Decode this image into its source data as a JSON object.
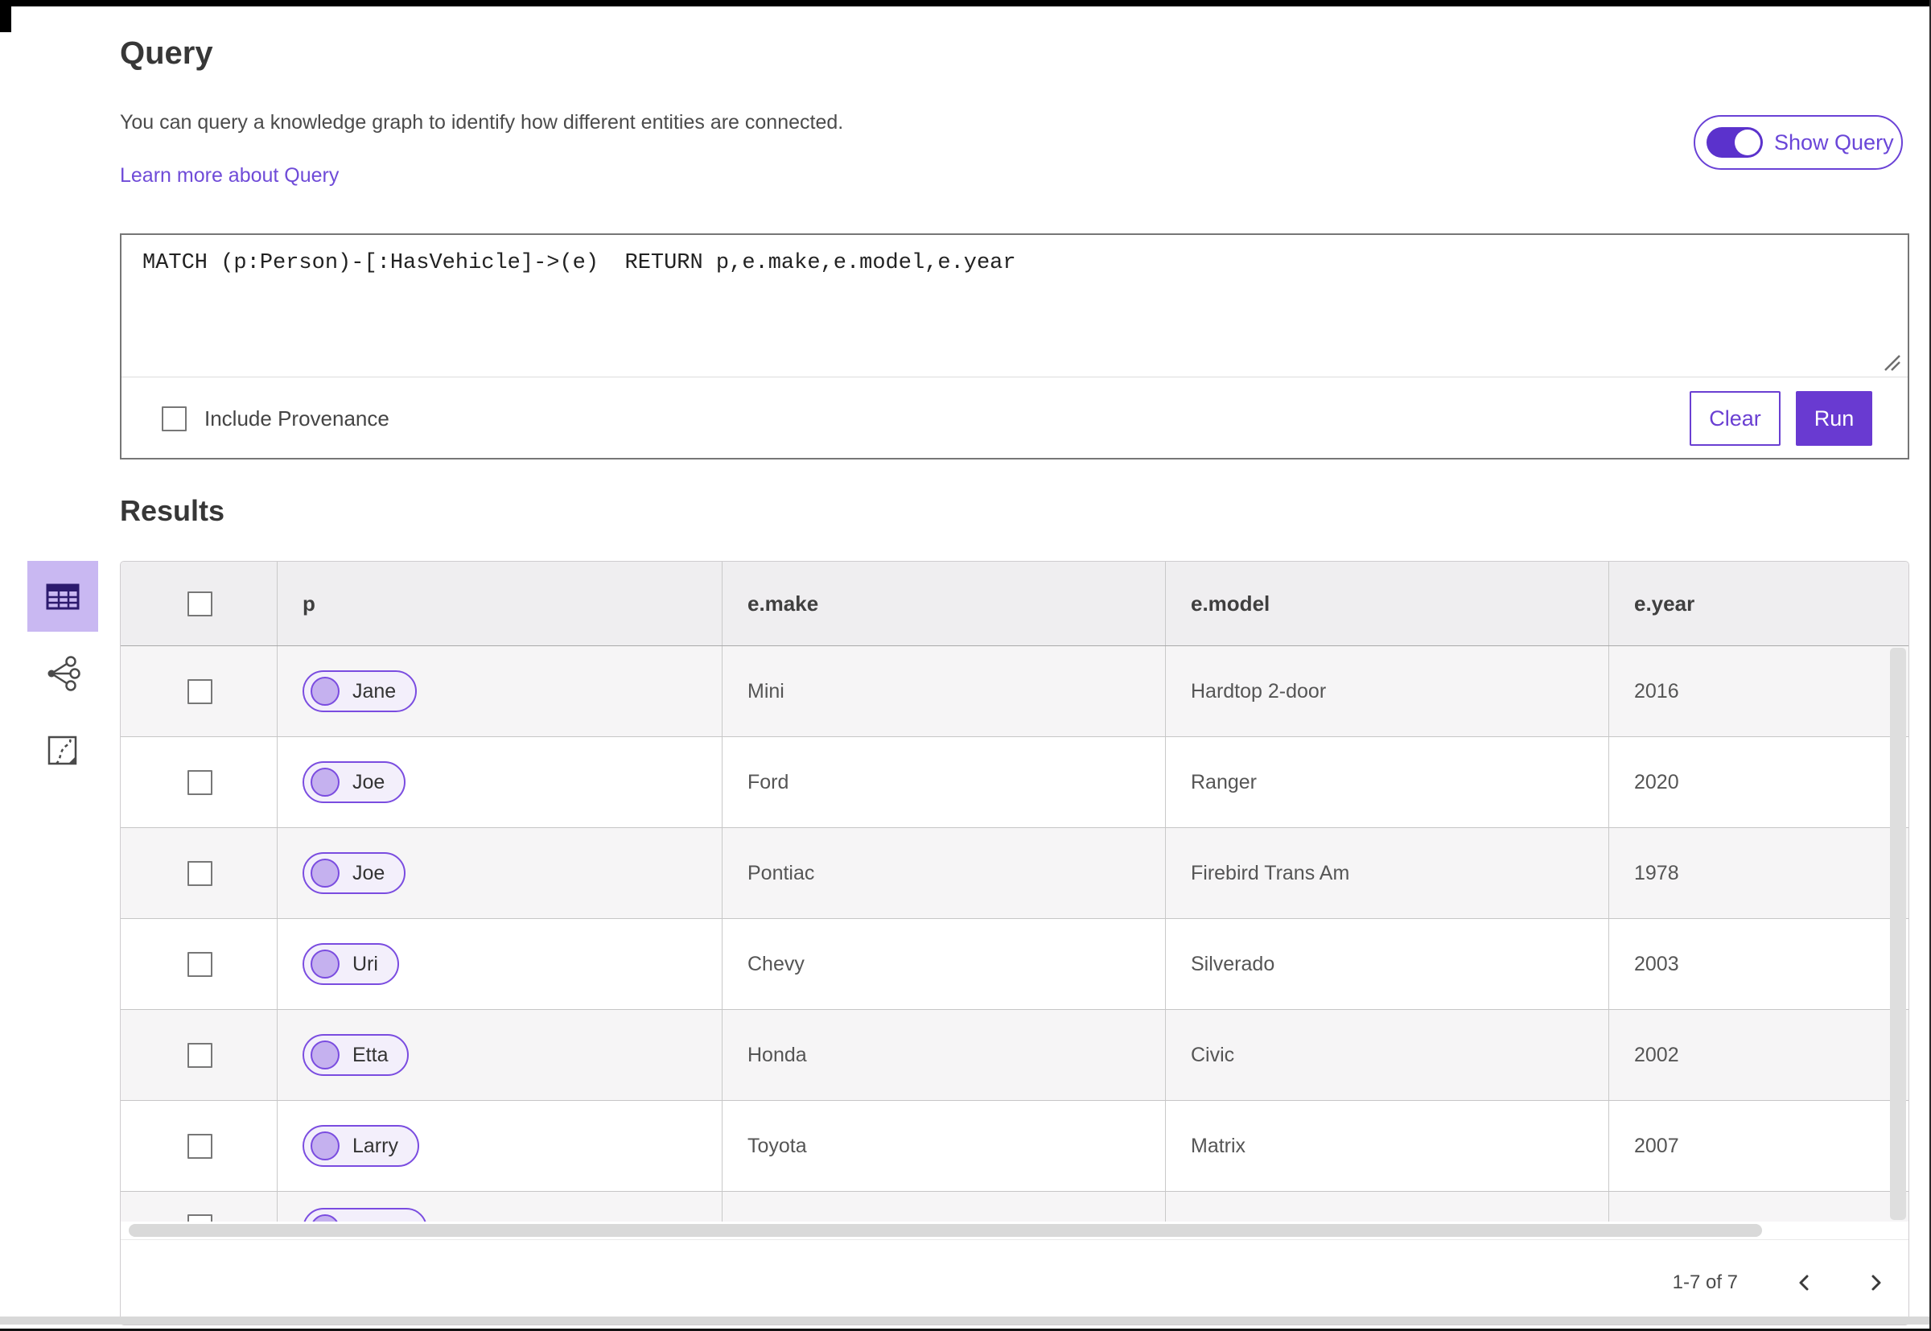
{
  "query_panel": {
    "title": "Query",
    "description": "You can query a knowledge graph to identify how different entities are connected.",
    "learn_more_link": "Learn more about Query",
    "show_query_toggle": {
      "label": "Show Query",
      "on": true
    },
    "query_text": "MATCH (p:Person)-[:HasVehicle]->(e)  RETURN p,e.make,e.model,e.year",
    "include_provenance": {
      "label": "Include Provenance",
      "checked": false
    },
    "clear_button_label": "Clear",
    "run_button_label": "Run"
  },
  "results_panel": {
    "title": "Results",
    "view_rail": [
      {
        "icon": "table-view-icon",
        "selected": true
      },
      {
        "icon": "link-chart-view-icon",
        "selected": false
      },
      {
        "icon": "map-view-icon",
        "selected": false
      }
    ],
    "table": {
      "columns": [
        "p",
        "e.make",
        "e.model",
        "e.year"
      ],
      "rows": [
        {
          "p": "Jane",
          "make": "Mini",
          "model": "Hardtop 2-door",
          "year": "2016"
        },
        {
          "p": "Joe",
          "make": "Ford",
          "model": "Ranger",
          "year": "2020"
        },
        {
          "p": "Joe",
          "make": "Pontiac",
          "model": "Firebird Trans Am",
          "year": "1978"
        },
        {
          "p": "Uri",
          "make": "Chevy",
          "model": "Silverado",
          "year": "2003"
        },
        {
          "p": "Etta",
          "make": "Honda",
          "model": "Civic",
          "year": "2002"
        },
        {
          "p": "Larry",
          "make": "Toyota",
          "model": "Matrix",
          "year": "2007"
        },
        {
          "p": "",
          "make": "",
          "model": "",
          "year": "",
          "partial": true
        }
      ]
    },
    "footer": {
      "range_label": "1-7 of 7",
      "prev_icon": "chevron-left-icon",
      "next_icon": "chevron-right-icon"
    }
  },
  "colors": {
    "accent_purple": "#693ad1",
    "selected_tile_purple": "#c9b8f2",
    "pill_border_purple": "#7a4ce0",
    "pill_circle_fill": "#c5b1ef",
    "header_gray": "#efeef0",
    "row_alt_gray": "#f6f5f6"
  }
}
